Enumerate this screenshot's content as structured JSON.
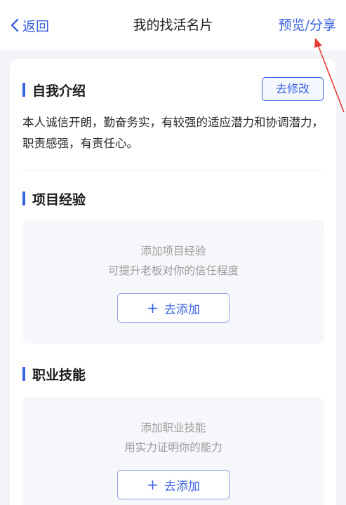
{
  "nav": {
    "back_label": "返回",
    "title": "我的找活名片",
    "action_label": "预览/分享"
  },
  "intro": {
    "title": "自我介绍",
    "edit_label": "去修改",
    "text": "本人诚信开朗，勤奋务实，有较强的适应潜力和协调潜力，职责感强，有责任心。"
  },
  "experience": {
    "title": "项目经验",
    "empty_line1": "添加项目经验",
    "empty_line2": "可提升老板对你的信任程度",
    "add_label": "去添加"
  },
  "skills": {
    "title": "职业技能",
    "empty_line1": "添加职业技能",
    "empty_line2": "用实力证明你的能力",
    "add_label": "去添加"
  },
  "icons": {
    "back": "chevron-left-icon",
    "add": "plus-icon",
    "annotation": "red-arrow"
  },
  "colors": {
    "accent": "#3b63e0",
    "annotation": "#e53935"
  }
}
